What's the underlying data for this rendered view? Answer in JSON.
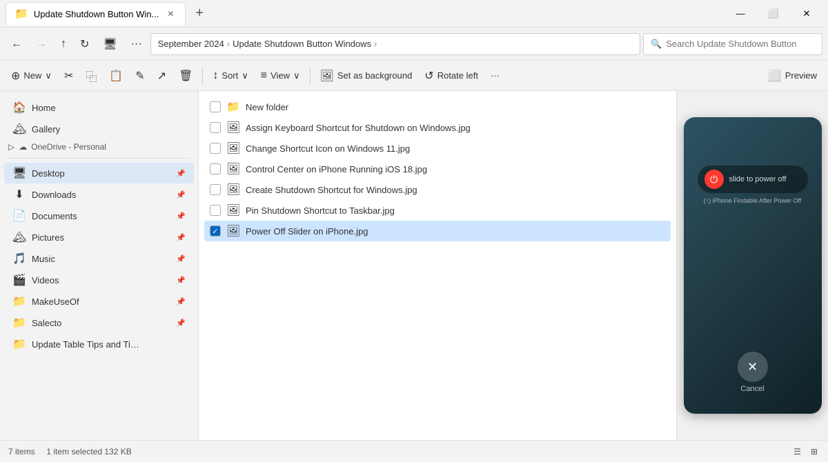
{
  "titleBar": {
    "tabIcon": "📁",
    "tabTitle": "Update Shutdown Button Win...",
    "newTabBtn": "+",
    "windowControls": [
      "—",
      "⬜",
      "✕"
    ]
  },
  "navBar": {
    "backBtn": "←",
    "forwardBtn": "→",
    "upBtn": "↑",
    "refreshBtn": "↻",
    "displayBtn": "🖥",
    "moreBtn": "···",
    "breadcrumb": [
      "September 2024",
      "Update Shutdown Button Windows"
    ],
    "searchPlaceholder": "Search Update Shutdown Button"
  },
  "toolbar": {
    "newLabel": "New",
    "cutIcon": "✂",
    "copyIcon": "⿻",
    "pasteIcon": "📋",
    "renameIcon": "✎",
    "shareIcon": "↗",
    "deleteIcon": "🗑",
    "sortLabel": "Sort",
    "viewLabel": "View",
    "setBackgroundLabel": "Set as background",
    "rotateLeftLabel": "Rotate left",
    "moreLabel": "···",
    "previewLabel": "Preview"
  },
  "sidebar": {
    "items": [
      {
        "id": "home",
        "icon": "🏠",
        "label": "Home",
        "pinned": false
      },
      {
        "id": "gallery",
        "icon": "🏔",
        "label": "Gallery",
        "pinned": false
      },
      {
        "id": "onedrive",
        "icon": "☁",
        "label": "OneDrive - Personal",
        "pinned": false,
        "group": true
      }
    ],
    "quickAccess": [
      {
        "id": "desktop",
        "icon": "🖥",
        "label": "Desktop",
        "pinned": true,
        "active": true
      },
      {
        "id": "downloads",
        "icon": "⬇",
        "label": "Downloads",
        "pinned": true
      },
      {
        "id": "documents",
        "icon": "📄",
        "label": "Documents",
        "pinned": true
      },
      {
        "id": "pictures",
        "icon": "🏔",
        "label": "Pictures",
        "pinned": true
      },
      {
        "id": "music",
        "icon": "🎵",
        "label": "Music",
        "pinned": true
      },
      {
        "id": "videos",
        "icon": "🎬",
        "label": "Videos",
        "pinned": true
      },
      {
        "id": "makeuseoff",
        "icon": "📁",
        "label": "MakeUseOf",
        "pinned": true
      },
      {
        "id": "salecto",
        "icon": "📁",
        "label": "Salecto",
        "pinned": true
      },
      {
        "id": "updatetable",
        "icon": "📁",
        "label": "Update Table Tips and Tips in Wor...",
        "pinned": false
      }
    ]
  },
  "files": [
    {
      "id": "newfolder",
      "icon": "📁",
      "name": "New folder",
      "type": "folder",
      "selected": false
    },
    {
      "id": "file1",
      "icon": "🖼",
      "name": "Assign Keyboard Shortcut for Shutdown on Windows.jpg",
      "type": "jpg",
      "selected": false
    },
    {
      "id": "file2",
      "icon": "🖼",
      "name": "Change Shortcut Icon on Windows 11.jpg",
      "type": "jpg",
      "selected": false
    },
    {
      "id": "file3",
      "icon": "🖼",
      "name": "Control Center on iPhone Running iOS 18.jpg",
      "type": "jpg",
      "selected": false
    },
    {
      "id": "file4",
      "icon": "🖼",
      "name": "Create Shutdown Shortcut for Windows.jpg",
      "type": "jpg",
      "selected": false
    },
    {
      "id": "file5",
      "icon": "🖼",
      "name": "Pin Shutdown Shortcut to Taskbar.jpg",
      "type": "jpg",
      "selected": false
    },
    {
      "id": "file6",
      "icon": "🖼",
      "name": "Power Off Slider on iPhone.jpg",
      "type": "jpg",
      "selected": true
    }
  ],
  "preview": {
    "sliderText": "slide to power off",
    "subtitleText": "(↑) iPhone Findable After Power Off",
    "cancelText": "Cancel"
  },
  "statusBar": {
    "itemCount": "7 items",
    "selectedInfo": "1 item selected  132 KB"
  }
}
